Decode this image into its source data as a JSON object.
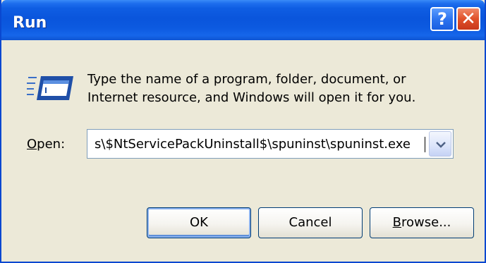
{
  "window": {
    "title": "Run",
    "help_label": "?",
    "close_label": "✕"
  },
  "description": {
    "line1": "Type the name of a program, folder, document, or",
    "line2": "Internet resource, and Windows will open it for you."
  },
  "open": {
    "label_accel": "O",
    "label_rest": "pen:",
    "value": "s\\$NtServicePackUninstall$\\spuninst\\spuninst.exe"
  },
  "buttons": {
    "ok": "OK",
    "cancel": "Cancel",
    "browse_accel": "B",
    "browse_rest": "rowse..."
  },
  "icons": {
    "run": "run-window-icon",
    "dropdown": "chevron-down-icon"
  },
  "colors": {
    "titlebar": "#0a55dc",
    "dialog_bg": "#ece9d8",
    "close": "#e0502a"
  }
}
